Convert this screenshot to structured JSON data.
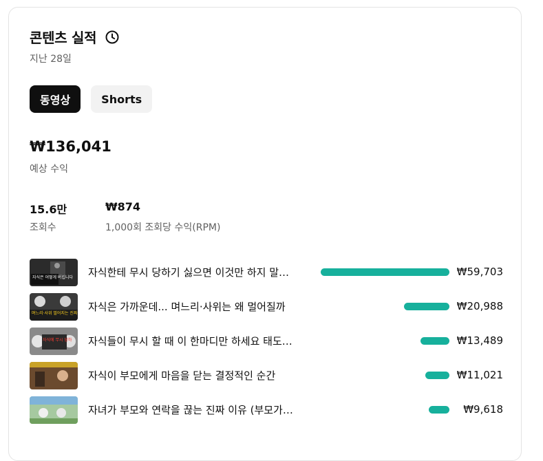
{
  "card": {
    "title": "콘텐츠 실적",
    "period": "지난 28일",
    "icon": "clock-icon"
  },
  "tabs": [
    {
      "label": "동영상",
      "active": true
    },
    {
      "label": "Shorts",
      "active": false
    }
  ],
  "revenue": {
    "value": "₩136,041",
    "label": "예상 수익"
  },
  "metrics": [
    {
      "value": "15.6만",
      "label": "조회수"
    },
    {
      "value": "₩874",
      "label": "1,000회 조회당 수익(RPM)"
    }
  ],
  "videos": [
    {
      "title": "자식한테 무시 당하기 싫으면 이것만 하지 말아라",
      "value_label": "₩59,703",
      "value": 59703,
      "thumb_text": "자식은 어떻게 버립니다"
    },
    {
      "title": "자식은 가까운데... 며느리·사위는 왜 멀어질까",
      "value_label": "₩20,988",
      "value": 20988,
      "thumb_text": "며느리·사위 멀어지는 진짜 이유"
    },
    {
      "title": "자식들이 무시 할 때 이 한마디만 하세요 태도가 바뀝니다",
      "value_label": "₩13,489",
      "value": 13489,
      "thumb_text": "자식에 무시 당하"
    },
    {
      "title": "자식이 부모에게 마음을 닫는 결정적인 순간",
      "value_label": "₩11,021",
      "value": 11021,
      "thumb_text": ""
    },
    {
      "title": "자녀가 부모와 연락을 끊는 진짜 이유 (부모가 모르는)",
      "value_label": "₩9,618",
      "value": 9618,
      "thumb_text": ""
    }
  ],
  "colors": {
    "bar": "#17b09c",
    "active_tab": "#0f0f0f",
    "inactive_tab": "#f2f2f2"
  }
}
